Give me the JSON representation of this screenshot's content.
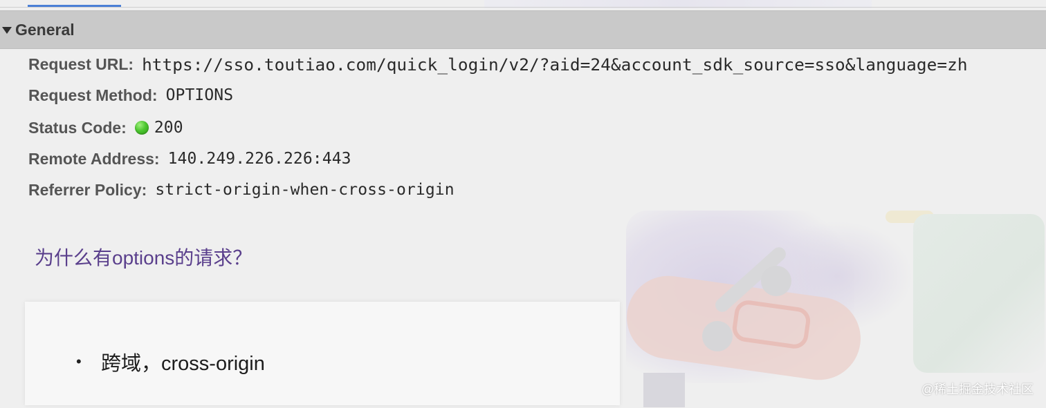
{
  "section": {
    "title": "General"
  },
  "headers": [
    {
      "label": "Request URL:",
      "value": "https://sso.toutiao.com/quick_login/v2/?aid=24&account_sdk_source=sso&language=zh"
    },
    {
      "label": "Request Method:",
      "value": "OPTIONS"
    },
    {
      "label": "Status Code:",
      "value": "200",
      "status_color": "#4cc62f"
    },
    {
      "label": "Remote Address:",
      "value": "140.249.226.226:443"
    },
    {
      "label": "Referrer Policy:",
      "value": "strict-origin-when-cross-origin"
    }
  ],
  "question": "为什么有options的请求？",
  "bullets": [
    {
      "marker": "•",
      "text": "跨域，cross-origin"
    }
  ],
  "watermark": "@稀土掘金技术社区",
  "colors": {
    "header_bg": "#c9c9c9",
    "tab_accent": "#4a7fd6",
    "question_text": "#5a3f8c"
  }
}
